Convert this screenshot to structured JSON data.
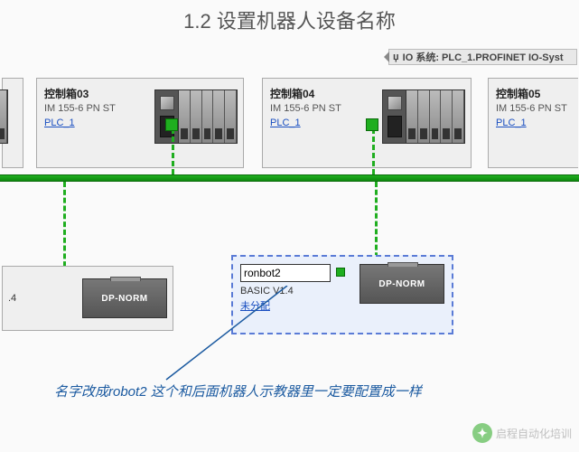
{
  "title": "1.2 设置机器人设备名称",
  "io_system": {
    "pin": "џ",
    "label": "IO 系统: PLC_1.PROFINET IO-Syst"
  },
  "panels": [
    {
      "name": "控制箱03",
      "sub": "IM 155-6 PN ST",
      "link": "PLC_1"
    },
    {
      "name": "控制箱04",
      "sub": "IM 155-6 PN ST",
      "link": "PLC_1"
    },
    {
      "name": "控制箱05",
      "sub": "IM 155-6 PN ST",
      "link": "PLC_1"
    }
  ],
  "dp_left_suffix": ".4",
  "dp_norm_label": "DP-NORM",
  "robot_edit": {
    "value": "ronbot2",
    "basic": "BASIC V1.4",
    "unassigned": "未分配"
  },
  "note": "名字改成robot2 这个和后面机器人示教器里一定要配置成一样",
  "watermark": "启程自动化培训"
}
